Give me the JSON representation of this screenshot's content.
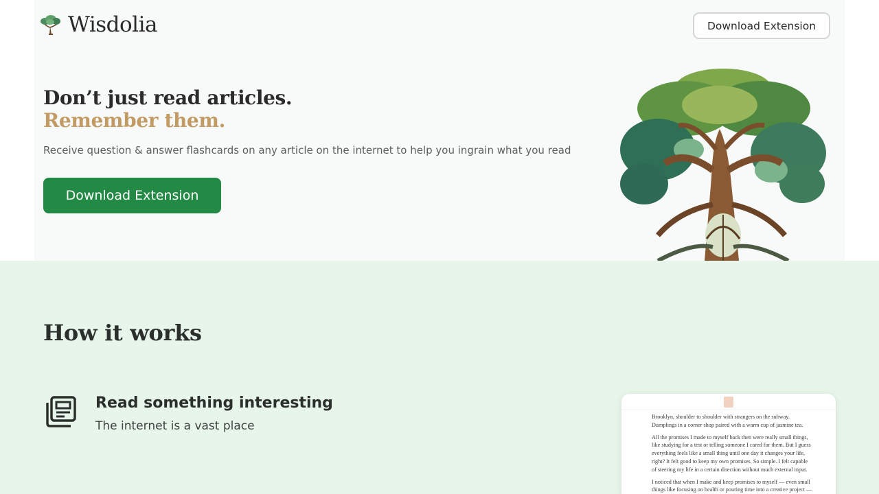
{
  "header": {
    "brand": "Wisdolia",
    "download_label": "Download Extension"
  },
  "hero": {
    "headline": "Don’t just read articles.",
    "headline_accent": "Remember them.",
    "subtitle": "Receive question & answer flashcards on any article on the internet to help you ingrain what you read",
    "cta_label": "Download Extension"
  },
  "how": {
    "title": "How it works",
    "steps": [
      {
        "icon": "newspaper-icon",
        "title": "Read something interesting",
        "description": "The internet is a vast place"
      }
    ]
  },
  "preview": {
    "paragraphs": [
      "Brooklyn, shoulder to shoulder with strangers on the subway. Dumplings in a corner shop paired with a warm cup of jasmine tea.",
      "All the promises I made to myself back then were really small things, like studying for a test or telling someone I cared for them. But I guess everything feels like a small thing until one day it changes your life, right? It felt good to keep my own promises. So simple. I felt capable of steering my life in a certain direction without much external input.",
      "I noticed that when I make and keep promises to myself — even small things like focusing on health or pouring time into a creative project — I"
    ]
  },
  "colors": {
    "cta_green": "#228a44",
    "accent_gold": "#c29a63",
    "section_mint": "#e8f5eb"
  }
}
